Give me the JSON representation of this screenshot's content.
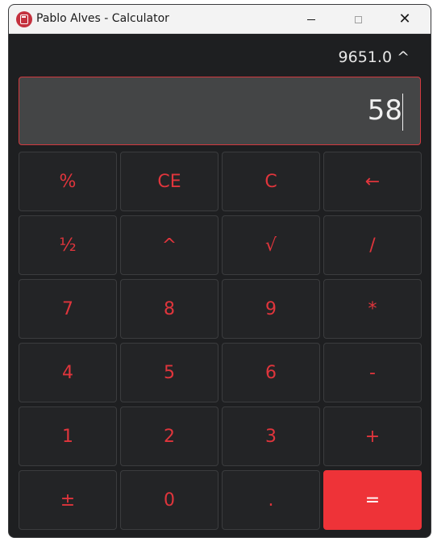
{
  "window": {
    "title": "Pablo Alves - Calculator",
    "icon": "calculator-icon",
    "controls": {
      "minimize": "minimize-icon",
      "maximize": "maximize-icon",
      "close_glyph": "✕"
    }
  },
  "history": "9651.0 ^",
  "display": {
    "value": "58"
  },
  "keys": [
    [
      "%",
      "CE",
      "C",
      "←"
    ],
    [
      "½",
      "^",
      "√",
      "/"
    ],
    [
      "7",
      "8",
      "9",
      "*"
    ],
    [
      "4",
      "5",
      "6",
      "-"
    ],
    [
      "1",
      "2",
      "3",
      "+"
    ],
    [
      "±",
      "0",
      ".",
      "="
    ]
  ],
  "colors": {
    "accent": "#ee3338",
    "key_text": "#e0353c",
    "background": "#1e1f21",
    "display_bg": "#444546"
  }
}
